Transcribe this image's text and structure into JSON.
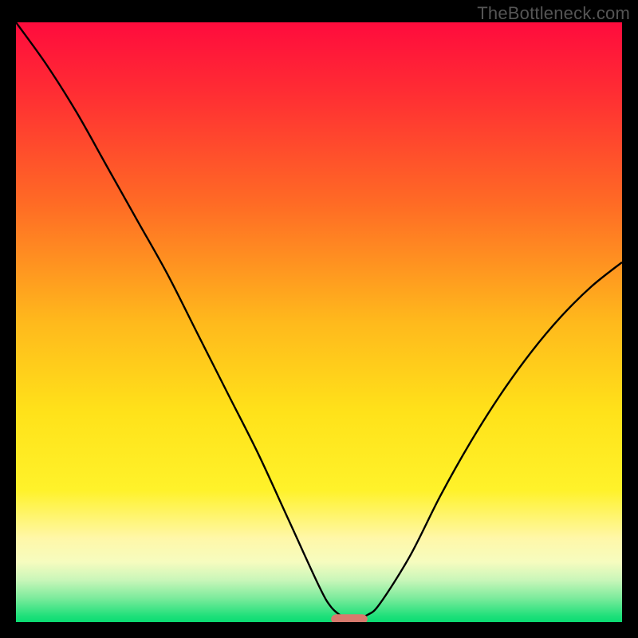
{
  "watermark": "TheBottleneck.com",
  "chart_data": {
    "type": "line",
    "title": "",
    "xlabel": "",
    "ylabel": "",
    "xlim": [
      0,
      100
    ],
    "ylim": [
      0,
      100
    ],
    "background_gradient_stops": [
      {
        "pct": 0,
        "color": "#ff0b3d"
      },
      {
        "pct": 12,
        "color": "#ff2e33"
      },
      {
        "pct": 30,
        "color": "#ff6a25"
      },
      {
        "pct": 50,
        "color": "#ffb91c"
      },
      {
        "pct": 65,
        "color": "#ffe21a"
      },
      {
        "pct": 78,
        "color": "#fff22a"
      },
      {
        "pct": 86,
        "color": "#fff7a8"
      },
      {
        "pct": 90,
        "color": "#f6fcbf"
      },
      {
        "pct": 93,
        "color": "#c9f6b9"
      },
      {
        "pct": 96,
        "color": "#7ceb9c"
      },
      {
        "pct": 99,
        "color": "#1fe07a"
      },
      {
        "pct": 100,
        "color": "#0bdc73"
      }
    ],
    "series": [
      {
        "name": "bottleneck-curve",
        "color": "#000000",
        "x": [
          0,
          5,
          10,
          15,
          20,
          25,
          30,
          35,
          40,
          45,
          50,
          52,
          54,
          55,
          56,
          58,
          60,
          65,
          70,
          75,
          80,
          85,
          90,
          95,
          100
        ],
        "y": [
          100,
          93,
          85,
          76,
          67,
          58,
          48,
          38,
          28,
          17,
          6,
          2.5,
          0.8,
          0.5,
          0.5,
          1.2,
          3,
          11,
          21,
          30,
          38,
          45,
          51,
          56,
          60
        ]
      }
    ],
    "marker": {
      "name": "optimal-point",
      "shape": "rounded-bar",
      "color": "#d87a6d",
      "x_center": 55,
      "y": 0.5,
      "width_x": 6,
      "height_y": 1.6
    }
  }
}
